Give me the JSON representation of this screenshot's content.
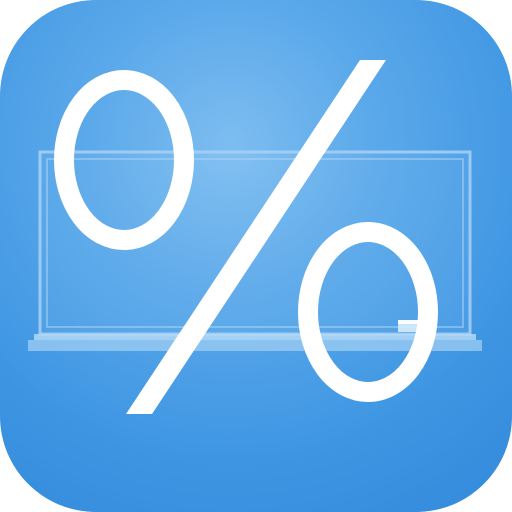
{
  "icon": {
    "symbol": "percent-sign",
    "background": "board-chalkboard",
    "colors": {
      "background_center": "#7dbdf0",
      "background_edge": "#3489db",
      "symbol": "#ffffff",
      "board_outline": "#a9d2f5"
    }
  }
}
